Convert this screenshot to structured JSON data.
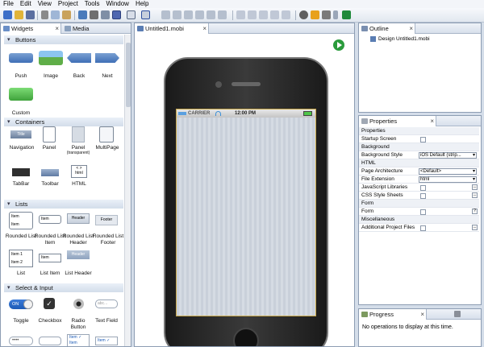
{
  "menubar": {
    "items": [
      "File",
      "Edit",
      "View",
      "Project",
      "Tools",
      "Window",
      "Help"
    ]
  },
  "toolbar": {
    "icons": [
      "new-icon",
      "open-icon",
      "save-icon",
      "cut-icon",
      "copy-icon",
      "paste-icon",
      "undo-icon",
      "mobile-icon",
      "layout-icon",
      "link-icon",
      "grid-icon",
      "align-icon",
      "settings-icon",
      "run-icon"
    ]
  },
  "left": {
    "tabs": [
      {
        "label": "Widgets"
      },
      {
        "label": "Media"
      }
    ],
    "sections": {
      "buttons": "Buttons",
      "containers": "Containers",
      "lists": "Lists",
      "select_input": "Select & Input"
    },
    "widgets": {
      "push": "Push",
      "image": "Image",
      "back": "Back",
      "next": "Next",
      "custom": "Custom",
      "navigation": "Navigation",
      "panel": "Panel",
      "panel_t1": "Panel",
      "panel_t2": "(transparent)",
      "multipage": "MultiPage",
      "tabbar": "TabBar",
      "toolbar": "Toolbar",
      "html": "HTML",
      "rounded_list": "Rounded List",
      "rounded_list_item": "Rounded List Item",
      "rounded_list_header": "Rounded List Header",
      "rounded_list_footer": "Rounded List Footer",
      "list": "List",
      "list_item": "List Item",
      "list_header": "List Header",
      "toggle": "Toggle",
      "checkbox": "Checkbox",
      "radio_button": "Radio Button",
      "text_field": "Text Field"
    },
    "glyphs": {
      "nav_title": "Title",
      "html_tag": "< >",
      "html_word": "html",
      "item": "Item",
      "header": "Header",
      "footer": "Footer",
      "item1": "Item 1",
      "item2": "Item 2",
      "toggle_on": "ON",
      "text_placeholder": "abc..."
    }
  },
  "editor": {
    "tab": "Untitled1.mobi",
    "carrier": "CARRIER",
    "time": "12:00 PM"
  },
  "outline": {
    "tab": "Outline",
    "item": "Design Untitled1.mobi"
  },
  "properties": {
    "tab": "Properties",
    "rows": [
      {
        "type": "cat",
        "label": "Properties"
      },
      {
        "type": "check",
        "label": "Startup Screen"
      },
      {
        "type": "cat",
        "label": "Background"
      },
      {
        "type": "dd",
        "label": "Background Style",
        "value": "iOS Default (strip..."
      },
      {
        "type": "cat",
        "label": "HTML"
      },
      {
        "type": "dd",
        "label": "Page Architecture",
        "value": "<Default>"
      },
      {
        "type": "dd",
        "label": "File Extension",
        "value": "html"
      },
      {
        "type": "btn",
        "label": "JavaScript Libraries",
        "value": "..."
      },
      {
        "type": "btn",
        "label": "CSS Style Sheets",
        "value": "..."
      },
      {
        "type": "cat",
        "label": "Form"
      },
      {
        "type": "checkq",
        "label": "Form",
        "value": "?"
      },
      {
        "type": "cat",
        "label": "Miscellaneous"
      },
      {
        "type": "btn",
        "label": "Additional Project Files",
        "value": "..."
      }
    ]
  },
  "progress": {
    "tab": "Progress",
    "message": "No operations to display at this time."
  }
}
